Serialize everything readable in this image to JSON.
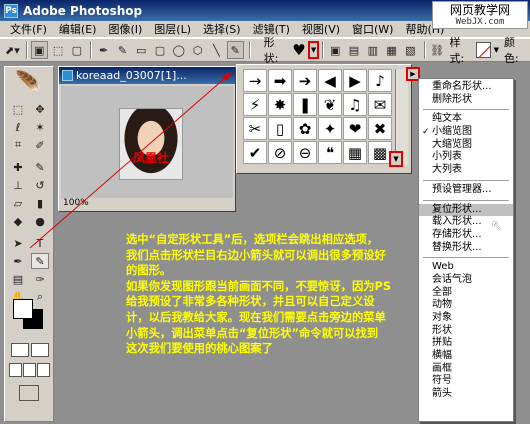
{
  "window": {
    "title": "Adobe Photoshop"
  },
  "watermark": {
    "line1": "网页教学网",
    "line2": "WebJX.com"
  },
  "menubar": [
    "文件(F)",
    "编辑(E)",
    "图像(I)",
    "图层(L)",
    "选择(S)",
    "滤镜(T)",
    "视图(V)",
    "窗口(W)",
    "帮助(H)"
  ],
  "options": {
    "shape_label": "形状:",
    "style_label": "样式:",
    "color_label": "颜色:"
  },
  "document": {
    "title": "koreaad_03007[1]...",
    "zoom": "100%",
    "photo_text": "凤凰社"
  },
  "shapes": [
    "→",
    "➡",
    "➔",
    "◀",
    "▶",
    "♪",
    "⚡",
    "✸",
    "❚",
    "❦",
    "♫",
    "✉",
    "✂",
    "▯",
    "✿",
    "✦",
    "❤",
    "✖",
    "✔",
    "⊘",
    "⊖",
    "❝",
    "▦",
    "▩"
  ],
  "context_menu": {
    "items": [
      {
        "label": "重命名形状...",
        "checked": false,
        "highlight": false
      },
      {
        "label": "删除形状",
        "checked": false,
        "highlight": false
      },
      {
        "sep": true
      },
      {
        "label": "纯文本",
        "checked": false,
        "highlight": false
      },
      {
        "label": "小缩览图",
        "checked": true,
        "highlight": false
      },
      {
        "label": "大缩览图",
        "checked": false,
        "highlight": false
      },
      {
        "label": "小列表",
        "checked": false,
        "highlight": false
      },
      {
        "label": "大列表",
        "checked": false,
        "highlight": false
      },
      {
        "sep": true
      },
      {
        "label": "预设管理器...",
        "checked": false,
        "highlight": false
      },
      {
        "sep": true
      },
      {
        "label": "复位形状...",
        "checked": false,
        "highlight": true
      },
      {
        "label": "载入形状...",
        "checked": false,
        "highlight": false
      },
      {
        "label": "存储形状...",
        "checked": false,
        "highlight": false
      },
      {
        "label": "替换形状...",
        "checked": false,
        "highlight": false
      },
      {
        "sep": true
      },
      {
        "label": "Web",
        "checked": false,
        "highlight": false
      },
      {
        "label": "会话气泡",
        "checked": false,
        "highlight": false
      },
      {
        "label": "全部",
        "checked": false,
        "highlight": false
      },
      {
        "label": "动物",
        "checked": false,
        "highlight": false
      },
      {
        "label": "对象",
        "checked": false,
        "highlight": false
      },
      {
        "label": "形状",
        "checked": false,
        "highlight": false
      },
      {
        "label": "拼贴",
        "checked": false,
        "highlight": false
      },
      {
        "label": "横幅",
        "checked": false,
        "highlight": false
      },
      {
        "label": "画框",
        "checked": false,
        "highlight": false
      },
      {
        "label": "符号",
        "checked": false,
        "highlight": false
      },
      {
        "label": "箭头",
        "checked": false,
        "highlight": false
      }
    ]
  },
  "annotation": {
    "lines": [
      "选中“自定形状工具”后，选项栏会跳出相应选项，",
      "我们点击形状栏目右边小箭头就可以调出很多预设好",
      "的图形。",
      "如果你发现图形跟当前画面不同，不要惊讶，因为PS",
      "给我预设了非常多各种形状，并且可以自己定义设",
      "计，以后我教给大家。现在我们需要点击旁边的菜单",
      "小箭头，调出菜单点击“复位形状”命令就可以找到",
      "这次我们要使用的桃心图案了"
    ]
  },
  "colors": {
    "accent": "#e00000",
    "annotation": "#ffff00",
    "titlebar": "#0a246a"
  }
}
